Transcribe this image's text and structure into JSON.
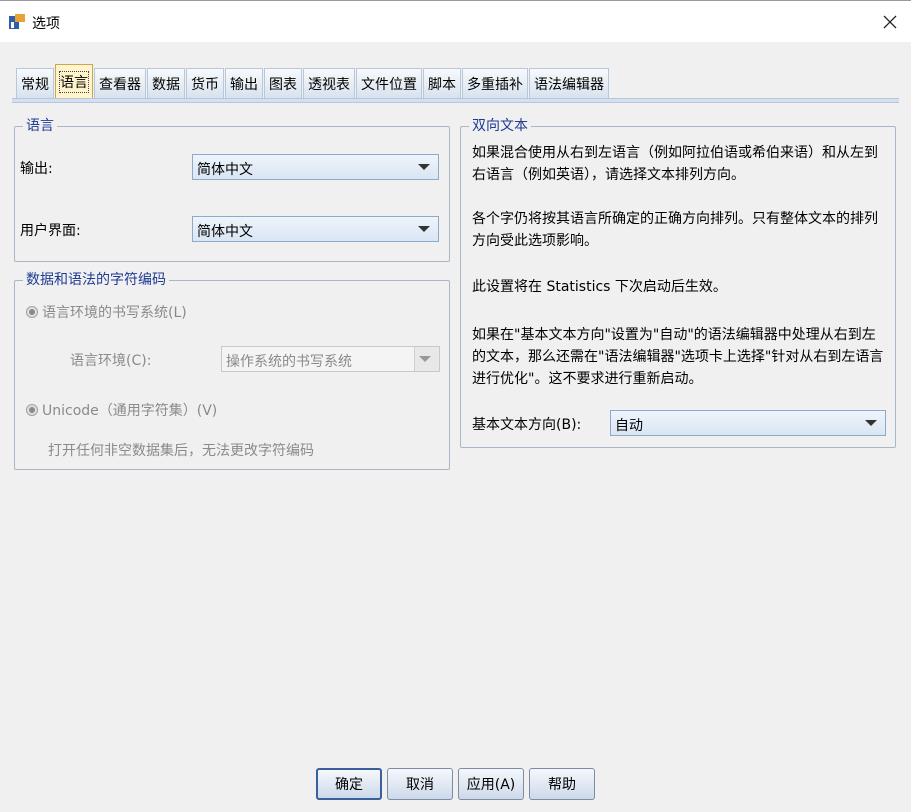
{
  "window": {
    "title": "选项",
    "close_glyph": "✕"
  },
  "tabs": [
    {
      "label": "常规",
      "active": false
    },
    {
      "label": "语言",
      "active": true
    },
    {
      "label": "查看器",
      "active": false
    },
    {
      "label": "数据",
      "active": false
    },
    {
      "label": "货币",
      "active": false
    },
    {
      "label": "输出",
      "active": false
    },
    {
      "label": "图表",
      "active": false
    },
    {
      "label": "透视表",
      "active": false
    },
    {
      "label": "文件位置",
      "active": false
    },
    {
      "label": "脚本",
      "active": false
    },
    {
      "label": "多重插补",
      "active": false
    },
    {
      "label": "语法编辑器",
      "active": false
    }
  ],
  "language_group": {
    "legend": "语言",
    "output_label": "输出:",
    "output_value": "简体中文",
    "ui_label": "用户界面:",
    "ui_value": "简体中文"
  },
  "encoding_group": {
    "legend": "数据和语法的字符编码",
    "locale_radio": "语言环境的书写系统(L)",
    "locale_label": "语言环境(C):",
    "locale_value": "操作系统的书写系统",
    "unicode_radio": "Unicode（通用字符集）(V)",
    "note": "打开任何非空数据集后，无法更改字符编码"
  },
  "bidi_group": {
    "legend": "双向文本",
    "p1": "如果混合使用从右到左语言（例如阿拉伯语或希伯来语）和从左到右语言（例如英语），请选择文本排列方向。",
    "p2": "各个字仍将按其语言所确定的正确方向排列。只有整体文本的排列方向受此选项影响。",
    "p3": "此设置将在 Statistics 下次启动后生效。",
    "p4": "如果在\"基本文本方向\"设置为\"自动\"的语法编辑器中处理从右到左的文本，那么还需在\"语法编辑器\"选项卡上选择\"针对从右到左语言进行优化\"。这不要求进行重新启动。",
    "direction_label": "基本文本方向(B):",
    "direction_value": "自动"
  },
  "buttons": {
    "ok": "确定",
    "cancel": "取消",
    "apply": "应用(A)",
    "help": "帮助"
  },
  "colors": {
    "legend_text": "#1f3a93",
    "tab_active": "#fff4cc",
    "body_bg": "#f0f0f0"
  }
}
